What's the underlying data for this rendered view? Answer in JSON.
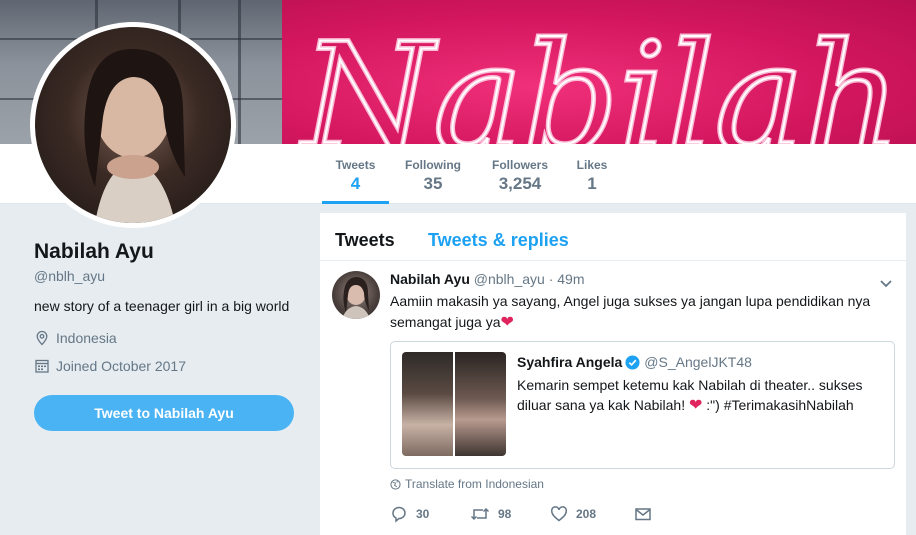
{
  "banner": {
    "text": "Nabilah"
  },
  "nav": [
    {
      "label": "Tweets",
      "value": "4"
    },
    {
      "label": "Following",
      "value": "35"
    },
    {
      "label": "Followers",
      "value": "3,254"
    },
    {
      "label": "Likes",
      "value": "1"
    }
  ],
  "profile": {
    "name": "Nabilah Ayu",
    "handle": "@nblh_ayu",
    "bio": "new story of a teenager girl in a big world",
    "location": "Indonesia",
    "joined": "Joined October 2017",
    "tweet_to_label": "Tweet to Nabilah Ayu"
  },
  "timeline": {
    "tabs": [
      "Tweets",
      "Tweets & replies"
    ],
    "tweet": {
      "name": "Nabilah Ayu",
      "handle": "@nblh_ayu",
      "time": "49m",
      "text_line1": "Aamiin makasih ya sayang, Angel juga sukses ya jangan lupa pendidikan nya",
      "text_line2": "semangat juga ya",
      "quote": {
        "name": "Syahfira Angela",
        "handle": "@S_AngelJKT48",
        "text_line1": "Kemarin sempet ketemu kak Nabilah di theater.. sukses",
        "text_line2_a": "diluar sana ya kak Nabilah!",
        "text_line2_b": ":\")  #TerimakasihNabilah"
      },
      "translate": "Translate from Indonesian",
      "actions": {
        "replies": "30",
        "retweets": "98",
        "likes": "208"
      }
    }
  },
  "colors": {
    "accent": "#1da1f2",
    "button": "#4ab3f4",
    "heart": "#e0245e",
    "banner_pink": "#d4175f"
  }
}
